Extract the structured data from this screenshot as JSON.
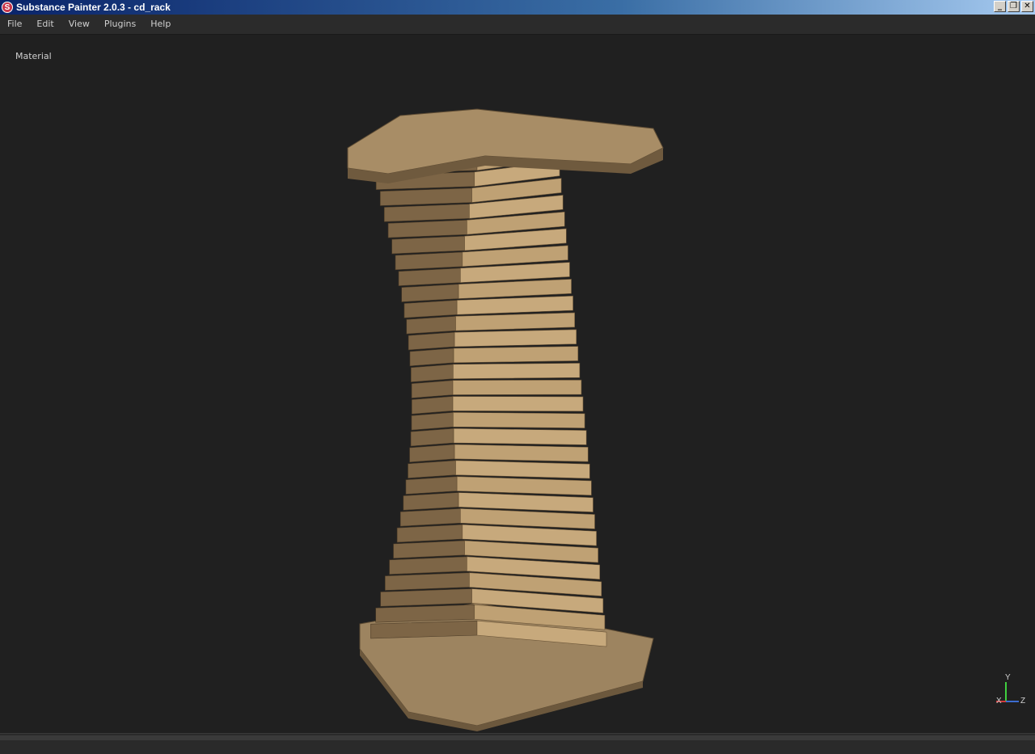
{
  "window": {
    "title": "Substance Painter 2.0.3 - cd_rack",
    "icon": "substance-painter-logo",
    "buttons": {
      "minimize": "_",
      "restore": "❐",
      "close": "✕"
    }
  },
  "menu": {
    "items": [
      {
        "label": "File"
      },
      {
        "label": "Edit"
      },
      {
        "label": "View"
      },
      {
        "label": "Plugins"
      },
      {
        "label": "Help"
      }
    ]
  },
  "viewport": {
    "mode_label": "Material",
    "axis": {
      "y": "Y",
      "x": "X",
      "z": "Z"
    }
  },
  "colors": {
    "background": "#202020",
    "wood_light": "#c9aa7c",
    "wood_dark": "#7a6244",
    "axis_y": "#3fcf3f",
    "axis_x": "#d03c3c",
    "axis_z": "#3c6cd0"
  }
}
